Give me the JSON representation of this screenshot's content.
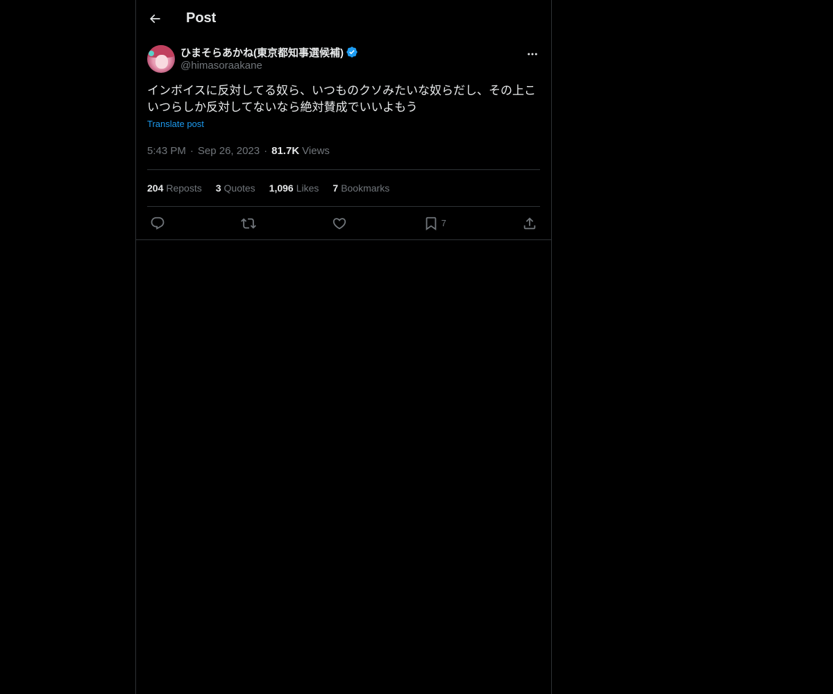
{
  "header": {
    "title": "Post",
    "back_icon": "arrow-left-icon"
  },
  "post": {
    "author": {
      "display_name": "ひまそらあかね(東京都知事選候補)",
      "handle": "@himasoraakane",
      "verified": true,
      "verified_color": "#1d9bf0"
    },
    "text_line1": "インボイスに反対してる奴ら、いつものクソみたいな奴らだし、その上こ",
    "text_line2": "いつらしか反対してないなら絶対賛成でいいよもう",
    "translate_label": "Translate post",
    "time": "5:43 PM",
    "separator": "·",
    "date": "Sep 26, 2023",
    "views_count": "81.7K",
    "views_label": "Views"
  },
  "stats": [
    {
      "num": "204",
      "label": "Reposts"
    },
    {
      "num": "3",
      "label": "Quotes"
    },
    {
      "num": "1,096",
      "label": "Likes"
    },
    {
      "num": "7",
      "label": "Bookmarks"
    }
  ],
  "actions": {
    "reply_icon": "reply-icon",
    "repost_icon": "repost-icon",
    "like_icon": "heart-icon",
    "bookmark_icon": "bookmark-icon",
    "bookmark_count": "7",
    "share_icon": "share-icon"
  },
  "colors": {
    "background": "#000000",
    "text_primary": "#e7e9ea",
    "text_secondary": "#71767b",
    "accent": "#1d9bf0",
    "border": "#2f3336"
  }
}
